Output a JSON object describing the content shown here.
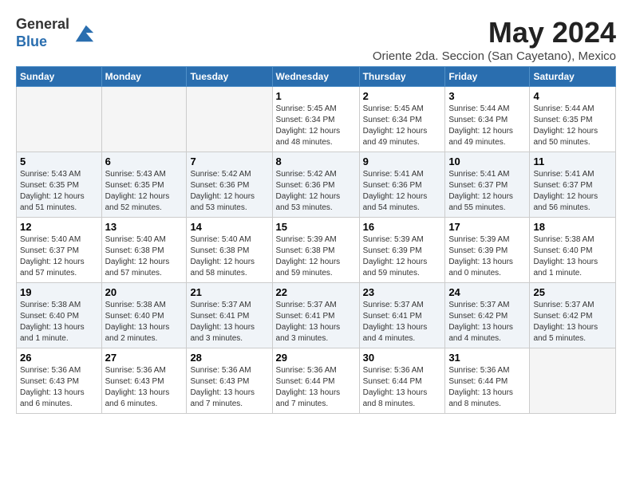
{
  "logo": {
    "general": "General",
    "blue": "Blue"
  },
  "title": "May 2024",
  "location": "Oriente 2da. Seccion (San Cayetano), Mexico",
  "days_of_week": [
    "Sunday",
    "Monday",
    "Tuesday",
    "Wednesday",
    "Thursday",
    "Friday",
    "Saturday"
  ],
  "weeks": [
    [
      {
        "day": "",
        "info": ""
      },
      {
        "day": "",
        "info": ""
      },
      {
        "day": "",
        "info": ""
      },
      {
        "day": "1",
        "info": "Sunrise: 5:45 AM\nSunset: 6:34 PM\nDaylight: 12 hours\nand 48 minutes."
      },
      {
        "day": "2",
        "info": "Sunrise: 5:45 AM\nSunset: 6:34 PM\nDaylight: 12 hours\nand 49 minutes."
      },
      {
        "day": "3",
        "info": "Sunrise: 5:44 AM\nSunset: 6:34 PM\nDaylight: 12 hours\nand 49 minutes."
      },
      {
        "day": "4",
        "info": "Sunrise: 5:44 AM\nSunset: 6:35 PM\nDaylight: 12 hours\nand 50 minutes."
      }
    ],
    [
      {
        "day": "5",
        "info": "Sunrise: 5:43 AM\nSunset: 6:35 PM\nDaylight: 12 hours\nand 51 minutes."
      },
      {
        "day": "6",
        "info": "Sunrise: 5:43 AM\nSunset: 6:35 PM\nDaylight: 12 hours\nand 52 minutes."
      },
      {
        "day": "7",
        "info": "Sunrise: 5:42 AM\nSunset: 6:36 PM\nDaylight: 12 hours\nand 53 minutes."
      },
      {
        "day": "8",
        "info": "Sunrise: 5:42 AM\nSunset: 6:36 PM\nDaylight: 12 hours\nand 53 minutes."
      },
      {
        "day": "9",
        "info": "Sunrise: 5:41 AM\nSunset: 6:36 PM\nDaylight: 12 hours\nand 54 minutes."
      },
      {
        "day": "10",
        "info": "Sunrise: 5:41 AM\nSunset: 6:37 PM\nDaylight: 12 hours\nand 55 minutes."
      },
      {
        "day": "11",
        "info": "Sunrise: 5:41 AM\nSunset: 6:37 PM\nDaylight: 12 hours\nand 56 minutes."
      }
    ],
    [
      {
        "day": "12",
        "info": "Sunrise: 5:40 AM\nSunset: 6:37 PM\nDaylight: 12 hours\nand 57 minutes."
      },
      {
        "day": "13",
        "info": "Sunrise: 5:40 AM\nSunset: 6:38 PM\nDaylight: 12 hours\nand 57 minutes."
      },
      {
        "day": "14",
        "info": "Sunrise: 5:40 AM\nSunset: 6:38 PM\nDaylight: 12 hours\nand 58 minutes."
      },
      {
        "day": "15",
        "info": "Sunrise: 5:39 AM\nSunset: 6:38 PM\nDaylight: 12 hours\nand 59 minutes."
      },
      {
        "day": "16",
        "info": "Sunrise: 5:39 AM\nSunset: 6:39 PM\nDaylight: 12 hours\nand 59 minutes."
      },
      {
        "day": "17",
        "info": "Sunrise: 5:39 AM\nSunset: 6:39 PM\nDaylight: 13 hours\nand 0 minutes."
      },
      {
        "day": "18",
        "info": "Sunrise: 5:38 AM\nSunset: 6:40 PM\nDaylight: 13 hours\nand 1 minute."
      }
    ],
    [
      {
        "day": "19",
        "info": "Sunrise: 5:38 AM\nSunset: 6:40 PM\nDaylight: 13 hours\nand 1 minute."
      },
      {
        "day": "20",
        "info": "Sunrise: 5:38 AM\nSunset: 6:40 PM\nDaylight: 13 hours\nand 2 minutes."
      },
      {
        "day": "21",
        "info": "Sunrise: 5:37 AM\nSunset: 6:41 PM\nDaylight: 13 hours\nand 3 minutes."
      },
      {
        "day": "22",
        "info": "Sunrise: 5:37 AM\nSunset: 6:41 PM\nDaylight: 13 hours\nand 3 minutes."
      },
      {
        "day": "23",
        "info": "Sunrise: 5:37 AM\nSunset: 6:41 PM\nDaylight: 13 hours\nand 4 minutes."
      },
      {
        "day": "24",
        "info": "Sunrise: 5:37 AM\nSunset: 6:42 PM\nDaylight: 13 hours\nand 4 minutes."
      },
      {
        "day": "25",
        "info": "Sunrise: 5:37 AM\nSunset: 6:42 PM\nDaylight: 13 hours\nand 5 minutes."
      }
    ],
    [
      {
        "day": "26",
        "info": "Sunrise: 5:36 AM\nSunset: 6:43 PM\nDaylight: 13 hours\nand 6 minutes."
      },
      {
        "day": "27",
        "info": "Sunrise: 5:36 AM\nSunset: 6:43 PM\nDaylight: 13 hours\nand 6 minutes."
      },
      {
        "day": "28",
        "info": "Sunrise: 5:36 AM\nSunset: 6:43 PM\nDaylight: 13 hours\nand 7 minutes."
      },
      {
        "day": "29",
        "info": "Sunrise: 5:36 AM\nSunset: 6:44 PM\nDaylight: 13 hours\nand 7 minutes."
      },
      {
        "day": "30",
        "info": "Sunrise: 5:36 AM\nSunset: 6:44 PM\nDaylight: 13 hours\nand 8 minutes."
      },
      {
        "day": "31",
        "info": "Sunrise: 5:36 AM\nSunset: 6:44 PM\nDaylight: 13 hours\nand 8 minutes."
      },
      {
        "day": "",
        "info": ""
      }
    ]
  ]
}
